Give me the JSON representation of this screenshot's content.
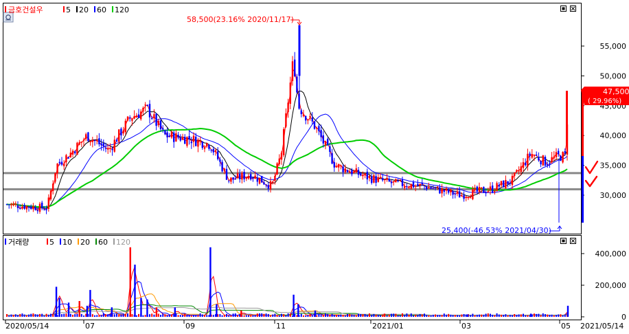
{
  "price_panel": {
    "legend": {
      "name": "금호건설우",
      "ma_items": [
        {
          "label": "5",
          "color": "#ff0000"
        },
        {
          "label": "20",
          "color": "#000000"
        },
        {
          "label": "60",
          "color": "#0000ff"
        },
        {
          "label": "120",
          "color": "#00cc00"
        }
      ]
    },
    "high_annotation": "58,500(23.16% 2020/11/17)",
    "low_annotation": "25,400(-46.53% 2021/04/30)",
    "last_price": "47,500",
    "last_change": "( 29.96%)"
  },
  "volume_panel": {
    "legend": {
      "name": "거래량",
      "ma_items": [
        {
          "label": "5",
          "color": "#ff0000"
        },
        {
          "label": "10",
          "color": "#0000ff"
        },
        {
          "label": "20",
          "color": "#ff9900"
        },
        {
          "label": "60",
          "color": "#008800"
        },
        {
          "label": "120",
          "color": "#999999"
        }
      ]
    }
  },
  "colors": {
    "up": "#ff0000",
    "down": "#0000ff",
    "support_line": "#888888",
    "check_mark": "#ff0000"
  },
  "x_axis_labels": [
    "2020/05/14",
    "07",
    "09",
    "11",
    "2021/01",
    "03",
    "05",
    "2021/05/14"
  ],
  "chart_data": [
    {
      "type": "candlestick",
      "y_ticks": [
        30000,
        35000,
        40000,
        45000,
        50000,
        55000
      ],
      "y_tick_labels": [
        "30,000",
        "35,000",
        "40,000",
        "45,000",
        "50,000",
        "55,000"
      ],
      "ylim": [
        25000,
        59000
      ],
      "horizontal_lines": [
        33700,
        31000
      ],
      "candles_close": [
        {
          "date": "2020-05-14",
          "close": 28500
        },
        {
          "date": "2020-06-10",
          "close": 27800
        },
        {
          "date": "2020-06-16",
          "close": 35000
        },
        {
          "date": "2020-06-25",
          "close": 37000
        },
        {
          "date": "2020-07-06",
          "close": 40000
        },
        {
          "date": "2020-07-20",
          "close": 37500
        },
        {
          "date": "2020-08-03",
          "close": 43000
        },
        {
          "date": "2020-08-14",
          "close": 44500
        },
        {
          "date": "2020-08-25",
          "close": 40000
        },
        {
          "date": "2020-09-10",
          "close": 39500
        },
        {
          "date": "2020-09-24",
          "close": 38500
        },
        {
          "date": "2020-10-06",
          "close": 32500
        },
        {
          "date": "2020-10-20",
          "close": 33500
        },
        {
          "date": "2020-11-03",
          "close": 31500
        },
        {
          "date": "2020-11-09",
          "close": 37000
        },
        {
          "date": "2020-11-17",
          "close": 53000
        },
        {
          "date": "2020-11-20",
          "close": 45000
        },
        {
          "date": "2020-12-01",
          "close": 41500
        },
        {
          "date": "2020-12-14",
          "close": 35000
        },
        {
          "date": "2021-01-04",
          "close": 33000
        },
        {
          "date": "2021-01-20",
          "close": 32000
        },
        {
          "date": "2021-02-10",
          "close": 31500
        },
        {
          "date": "2021-03-05",
          "close": 30000
        },
        {
          "date": "2021-03-25",
          "close": 31000
        },
        {
          "date": "2021-04-08",
          "close": 32500
        },
        {
          "date": "2021-04-20",
          "close": 37000
        },
        {
          "date": "2021-04-30",
          "close": 35500
        },
        {
          "date": "2021-05-07",
          "close": 36500
        },
        {
          "date": "2021-05-13",
          "close": 36600
        },
        {
          "date": "2021-05-14",
          "close": 47500
        }
      ]
    },
    {
      "type": "bar",
      "name": "거래량",
      "y_ticks": [
        0,
        200000,
        400000
      ],
      "y_tick_labels": [
        "0",
        "200,000",
        "400,000"
      ],
      "ylim": [
        0,
        480000
      ],
      "bars": [
        {
          "date": "2020-06-16",
          "value": 190000
        },
        {
          "date": "2020-06-18",
          "value": 120000
        },
        {
          "date": "2020-06-24",
          "value": 90000
        },
        {
          "date": "2020-07-01",
          "value": 100000
        },
        {
          "date": "2020-07-06",
          "value": 70000
        },
        {
          "date": "2020-07-08",
          "value": 170000
        },
        {
          "date": "2020-07-22",
          "value": 60000
        },
        {
          "date": "2020-08-03",
          "value": 440000
        },
        {
          "date": "2020-08-06",
          "value": 330000
        },
        {
          "date": "2020-08-10",
          "value": 120000
        },
        {
          "date": "2020-08-14",
          "value": 110000
        },
        {
          "date": "2020-08-20",
          "value": 60000
        },
        {
          "date": "2020-09-01",
          "value": 60000
        },
        {
          "date": "2020-09-24",
          "value": 440000
        },
        {
          "date": "2020-09-28",
          "value": 80000
        },
        {
          "date": "2020-10-14",
          "value": 40000
        },
        {
          "date": "2020-11-17",
          "value": 140000
        },
        {
          "date": "2020-11-20",
          "value": 80000
        },
        {
          "date": "2020-12-01",
          "value": 40000
        },
        {
          "date": "2021-01-15",
          "value": 20000
        },
        {
          "date": "2021-03-10",
          "value": 15000
        },
        {
          "date": "2021-04-20",
          "value": 20000
        },
        {
          "date": "2021-05-14",
          "value": 70000
        }
      ]
    }
  ]
}
